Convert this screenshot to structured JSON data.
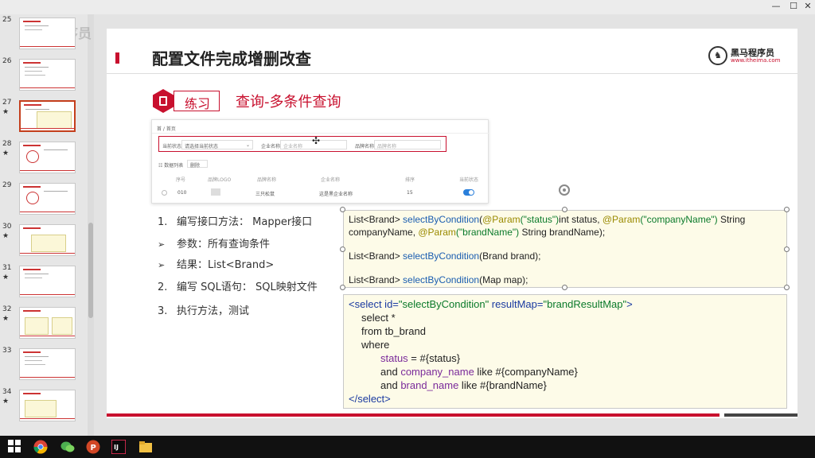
{
  "window": {
    "tabbar_text": ""
  },
  "thumbnails": [
    {
      "num": "25",
      "star": ""
    },
    {
      "num": "26",
      "star": ""
    },
    {
      "num": "27",
      "star": "★"
    },
    {
      "num": "28",
      "star": "★"
    },
    {
      "num": "29",
      "star": ""
    },
    {
      "num": "30",
      "star": "★"
    },
    {
      "num": "31",
      "star": "★"
    },
    {
      "num": "32",
      "star": "★"
    },
    {
      "num": "33",
      "star": ""
    },
    {
      "num": "34",
      "star": "★"
    }
  ],
  "watermark": "黑马程序员 bilibili",
  "slide": {
    "title": "配置文件完成增删改查",
    "logo_brand": "黑马程序员",
    "logo_url": "www.itheima.com",
    "badge_label": "练习",
    "subtitle": "查询-多条件查询",
    "shot": {
      "crumb": "首 / 首页",
      "f1_label": "当前状态",
      "f1_value": "请选择当前状态",
      "f2_label": "企业名称",
      "f2_placeholder": "企业名称",
      "f3_label": "品牌名称",
      "f3_placeholder": "品牌名称",
      "list_header": "☷ 数据列表",
      "delete_btn": "删除",
      "cols": [
        "序号",
        "品牌LOGO",
        "品牌名称",
        "企业名称",
        "排序",
        "当前状态"
      ],
      "row": {
        "id": "010",
        "brand": "三只松鼠",
        "company": "这是黑企业名称",
        "order": "15"
      }
    },
    "steps": [
      {
        "marker": "1.",
        "text": "编写接口方法： Mapper接口"
      },
      {
        "marker": "➢",
        "text": "参数：所有查询条件"
      },
      {
        "marker": "➢",
        "text": "结果：List<Brand>"
      },
      {
        "marker": "2.",
        "text": "编写 SQL语句： SQL映射文件"
      },
      {
        "marker": "3.",
        "text": "执行方法，测试"
      }
    ],
    "code1": {
      "l1_a": "List<Brand> ",
      "l1_m": "selectByCondition",
      "l1_b": "(",
      "l1_ann1": "@Param",
      "l1_s1": "(\"status\")",
      "l1_c": "int status, ",
      "l1_ann2": "@Param",
      "l1_s2": "(\"companyName\")",
      "l1_d": " String",
      "l2_a": "companyName, ",
      "l2_ann": "@Param",
      "l2_s": "(\"brandName\")",
      "l2_b": " String brandName);",
      "l3_a": "List<Brand> ",
      "l3_m": "selectByCondition",
      "l3_b": "(Brand brand);",
      "l4_a": "List<Brand> ",
      "l4_m": "selectByCondition",
      "l4_b": "(Map map);"
    },
    "code2": {
      "l1_tag": "<select",
      "l1_a1": " id=",
      "l1_v1": "\"selectByCondition\"",
      "l1_a2": " resultMap=",
      "l1_v2": "\"brandResultMap\"",
      "l1_end": ">",
      "l2": "select *",
      "l3": "from tb_brand",
      "l4": "where",
      "l5_col": "status",
      "l5_rest": " = #{status}",
      "l6_and": "and ",
      "l6_col": "company_name",
      "l6_rest": " like #{companyName}",
      "l7_and": "and ",
      "l7_col": "brand_name",
      "l7_rest": " like #{brandName}",
      "l8": "</select>"
    }
  },
  "colors": {
    "accent_red": "#c8102e",
    "code_bg": "#fdfbe8"
  }
}
